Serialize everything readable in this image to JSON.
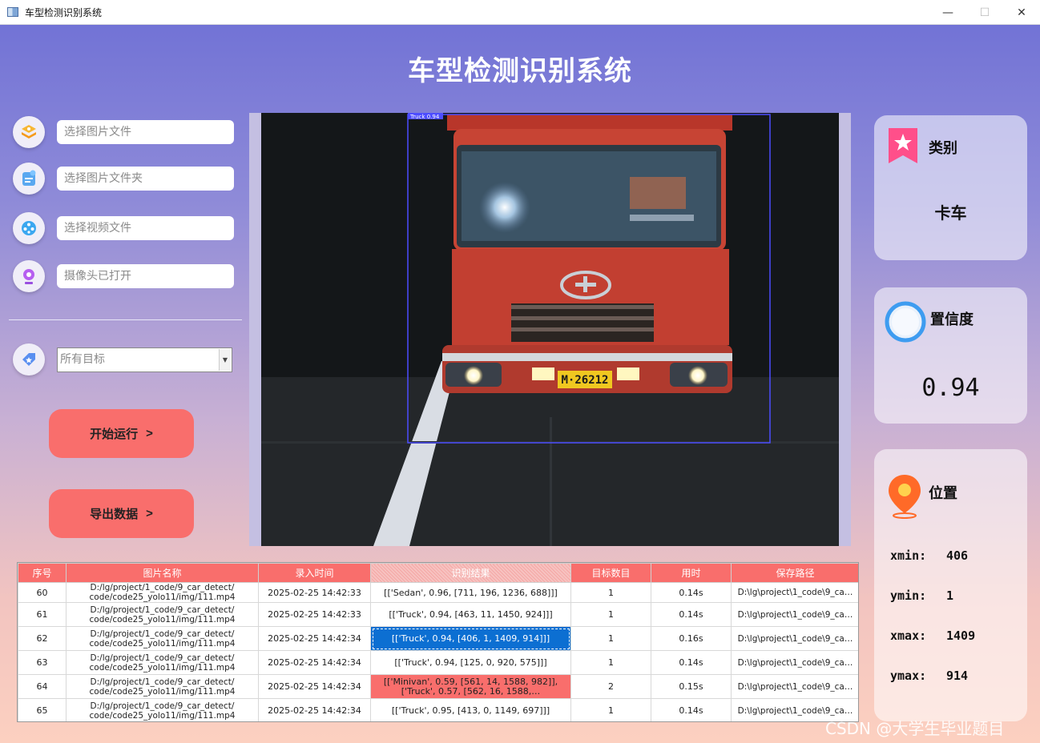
{
  "window": {
    "title": "车型检测识别系统",
    "minimize": "—",
    "maximize": "☐",
    "close": "✕"
  },
  "header": {
    "title": "车型检测识别系统"
  },
  "inputs": {
    "image_file": "选择图片文件",
    "image_folder": "选择图片文件夹",
    "video_file": "选择视频文件",
    "camera": "摄像头已打开"
  },
  "target_select": {
    "selected": "所有目标"
  },
  "buttons": {
    "start": "开始运行",
    "export": "导出数据",
    "chevron": ">"
  },
  "detection": {
    "box_label": "Truck 0.94",
    "plate": "M·26212"
  },
  "result_cards": {
    "class_label": "类别",
    "class_value": "卡车",
    "confidence_label": "置信度",
    "confidence_value": "0.94",
    "position_label": "位置",
    "xmin_label": "xmin:",
    "xmin": "406",
    "ymin_label": "ymin:",
    "ymin": "1",
    "xmax_label": "xmax:",
    "xmax": "1409",
    "ymax_label": "ymax:",
    "ymax": "914"
  },
  "table": {
    "headers": [
      "序号",
      "图片名称",
      "录入时间",
      "识别结果",
      "目标数目",
      "用时",
      "保存路径"
    ],
    "rows": [
      {
        "id": "60",
        "name": "D:/lg/project/1_code/9_car_detect/ code/code25_yolo11/img/111.mp4",
        "time": "2025-02-25 14:42:33",
        "result": "[['Sedan', 0.96, [711, 196, 1236, 688]]]",
        "count": "1",
        "duration": "0.14s",
        "path": "D:\\lg\\project\\1_code\\9_ca…"
      },
      {
        "id": "61",
        "name": "D:/lg/project/1_code/9_car_detect/ code/code25_yolo11/img/111.mp4",
        "time": "2025-02-25 14:42:33",
        "result": "[['Truck', 0.94, [463, 11, 1450, 924]]]",
        "count": "1",
        "duration": "0.14s",
        "path": "D:\\lg\\project\\1_code\\9_ca…"
      },
      {
        "id": "62",
        "name": "D:/lg/project/1_code/9_car_detect/ code/code25_yolo11/img/111.mp4",
        "time": "2025-02-25 14:42:34",
        "result": "[['Truck', 0.94, [406, 1, 1409, 914]]]",
        "count": "1",
        "duration": "0.16s",
        "path": "D:\\lg\\project\\1_code\\9_ca…"
      },
      {
        "id": "63",
        "name": "D:/lg/project/1_code/9_car_detect/ code/code25_yolo11/img/111.mp4",
        "time": "2025-02-25 14:42:34",
        "result": "[['Truck', 0.94, [125, 0, 920, 575]]]",
        "count": "1",
        "duration": "0.14s",
        "path": "D:\\lg\\project\\1_code\\9_ca…"
      },
      {
        "id": "64",
        "name": "D:/lg/project/1_code/9_car_detect/ code/code25_yolo11/img/111.mp4",
        "time": "2025-02-25 14:42:34",
        "result": "[['Minivan', 0.59, [561, 14, 1588, 982]], ['Truck', 0.57, [562, 16, 1588,…",
        "count": "2",
        "duration": "0.15s",
        "path": "D:\\lg\\project\\1_code\\9_ca…"
      },
      {
        "id": "65",
        "name": "D:/lg/project/1_code/9_car_detect/ code/code25_yolo11/img/111.mp4",
        "time": "2025-02-25 14:42:34",
        "result": "[['Truck', 0.95, [413, 0, 1149, 697]]]",
        "count": "1",
        "duration": "0.14s",
        "path": "D:\\lg\\project\\1_code\\9_ca…"
      }
    ]
  },
  "watermark": "CSDN @大学生毕业题目",
  "colors": {
    "accent": "#f96e6c",
    "header_gradient_top": "#7273d6",
    "selected_row": "#0c6fd2"
  }
}
